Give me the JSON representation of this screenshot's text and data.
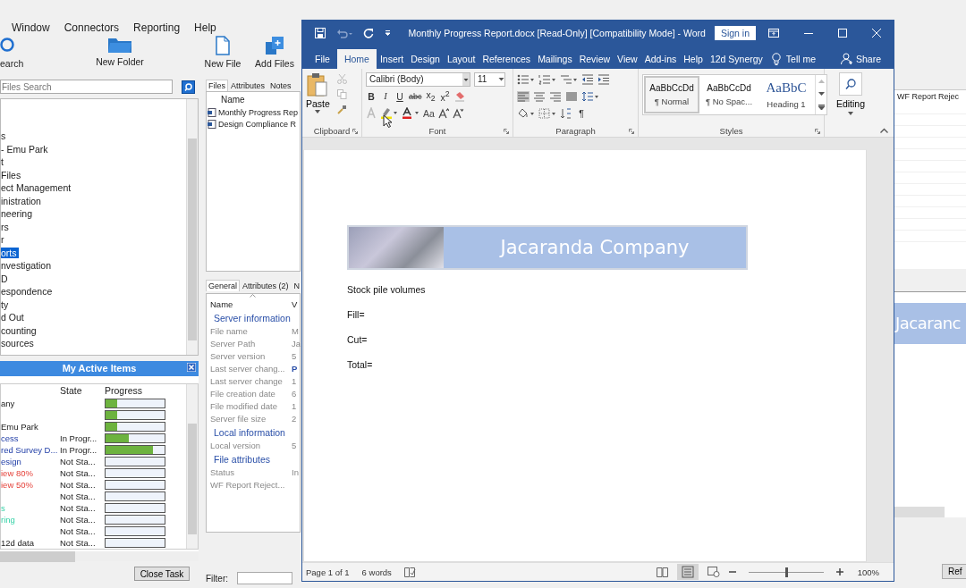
{
  "app": {
    "menu": [
      "Window",
      "Connectors",
      "Reporting",
      "Help"
    ],
    "toolbar": [
      {
        "label": "earch",
        "kind": "search"
      },
      {
        "label": "New Folder",
        "kind": "folder"
      },
      {
        "label": "New File",
        "kind": "file"
      },
      {
        "label": "Add Files",
        "kind": "add"
      }
    ],
    "search": {
      "placeholder": "Files Search"
    },
    "tree": [
      {
        "label": "s",
        "selected": false
      },
      {
        "label": "- Emu Park",
        "selected": false
      },
      {
        "label": "t",
        "selected": false
      },
      {
        "label": "Files",
        "selected": false
      },
      {
        "label": "ect Management",
        "selected": false
      },
      {
        "label": "inistration",
        "selected": false
      },
      {
        "label": "neering",
        "selected": false
      },
      {
        "label": "rs",
        "selected": false
      },
      {
        "label": "r",
        "selected": false
      },
      {
        "label": "orts",
        "selected": true
      },
      {
        "label": "nvestigation",
        "selected": false
      },
      {
        "label": "D",
        "selected": false
      },
      {
        "label": "espondence",
        "selected": false
      },
      {
        "label": "ty",
        "selected": false
      },
      {
        "label": "d Out",
        "selected": false
      },
      {
        "label": "counting",
        "selected": false
      },
      {
        "label": "sources",
        "selected": false
      }
    ],
    "active_items": {
      "title": "My Active Items",
      "columns": [
        "State",
        "Progress"
      ],
      "rows": [
        {
          "name": "any",
          "kind": "black",
          "level": 0.2
        },
        {
          "level": 0.2
        },
        {
          "name": "Emu Park",
          "kind": "black",
          "level": 0.2
        },
        {
          "name": "cess",
          "kind": "blue",
          "state": "In Progr...",
          "level": 0.4
        },
        {
          "name": "red Survey D...",
          "kind": "blue",
          "state": "In Progr...",
          "level": 0.8
        },
        {
          "name": "esign",
          "kind": "blue",
          "state": "Not Sta...",
          "level": 0
        },
        {
          "name": "iew 80%",
          "kind": "red",
          "state": "Not Sta...",
          "level": 0
        },
        {
          "name": "iew 50%",
          "kind": "red",
          "state": "Not Sta...",
          "level": 0
        },
        {
          "state": "Not Sta...",
          "level": 0
        },
        {
          "name": "s",
          "kind": "teal",
          "state": "Not Sta...",
          "level": 0
        },
        {
          "name": "ring",
          "kind": "teal",
          "state": "Not Sta...",
          "level": 0
        },
        {
          "state": "Not Sta...",
          "level": 0
        },
        {
          "name": "12d data",
          "kind": "black",
          "state": "Not Sta...",
          "level": 0
        }
      ],
      "button": "Close Task"
    },
    "file_tabs": [
      {
        "label": "Files",
        "selected": true
      },
      {
        "label": "Attributes",
        "selected": false
      },
      {
        "label": "Notes",
        "selected": false
      }
    ],
    "files": {
      "column": "Name",
      "rows": [
        "Monthly Progress Rep",
        "Design Compliance R"
      ]
    },
    "detail_tabs": [
      {
        "label": "General",
        "selected": true
      },
      {
        "label": "Attributes (2)",
        "selected": false
      },
      {
        "label": "N",
        "selected": false
      }
    ],
    "properties": {
      "columns": [
        "Name",
        "V"
      ],
      "groups": [
        {
          "title": "Server information",
          "rows": [
            {
              "name": "File name",
              "value": "M",
              "kind": "text"
            },
            {
              "name": "Server Path",
              "value": "Ja",
              "kind": "text"
            },
            {
              "name": "Server version",
              "value": "5",
              "kind": "text"
            },
            {
              "name": "Last server chang...",
              "value": "P",
              "kind": "link"
            },
            {
              "name": "Last server change",
              "value": "1",
              "kind": "text"
            },
            {
              "name": "File creation date",
              "value": "6",
              "kind": "text"
            },
            {
              "name": "File modified date",
              "value": "1",
              "kind": "text"
            },
            {
              "name": "Server file size",
              "value": "2",
              "kind": "text"
            }
          ]
        },
        {
          "title": "Local information",
          "rows": [
            {
              "name": "Local version",
              "value": "5",
              "kind": "text"
            }
          ]
        },
        {
          "title": "File attributes",
          "rows": [
            {
              "name": "Status",
              "value": "In",
              "kind": "text"
            },
            {
              "name": "WF Report Reject..."
            }
          ]
        }
      ]
    },
    "filter": {
      "label": "Filter:"
    },
    "side": {
      "column": "WF Report Rejec",
      "preview": "Jacaranc",
      "button": "Ref"
    }
  },
  "word": {
    "title": "Monthly Progress Report.docx [Read-Only] [Compatibility Mode]  -  Word",
    "sign_in": "Sign in",
    "tabs": [
      {
        "label": "File",
        "selected": false
      },
      {
        "label": "Home",
        "selected": true
      },
      {
        "label": "Insert",
        "selected": false
      },
      {
        "label": "Design",
        "selected": false
      },
      {
        "label": "Layout",
        "selected": false
      },
      {
        "label": "References",
        "selected": false
      },
      {
        "label": "Mailings",
        "selected": false
      },
      {
        "label": "Review",
        "selected": false
      },
      {
        "label": "View",
        "selected": false
      },
      {
        "label": "Add-ins",
        "selected": false
      },
      {
        "label": "Help",
        "selected": false
      },
      {
        "label": "12d Synergy",
        "selected": false
      }
    ],
    "tell_me": "Tell me",
    "share": "Share",
    "ribbon": {
      "clipboard": {
        "paste": "Paste",
        "label": "Clipboard"
      },
      "font": {
        "fields": [
          "Calibri (Body)",
          "11"
        ],
        "buttons": [
          {
            "label": "B",
            "kind": "bold"
          },
          {
            "label": "I",
            "kind": "italic"
          },
          {
            "label": "U",
            "kind": "underline"
          },
          {
            "label": "abc",
            "kind": "strike"
          },
          {
            "label": "x$_{2}$",
            "kind": "plain"
          },
          {
            "label": "x$^{2}$",
            "kind": "plain"
          }
        ],
        "case": "Aa",
        "label": "Font"
      },
      "paragraph": {
        "pilcrow": "¶",
        "label": "Paragraph"
      },
      "styles": {
        "items": [
          {
            "preview": "AaBbCcDd",
            "name": "¶ Normal",
            "kind": "body",
            "selected": true
          },
          {
            "preview": "AaBbCcDd",
            "name": "¶ No Spac...",
            "kind": "body",
            "selected": false
          },
          {
            "preview": "AaBbC",
            "name": "Heading 1",
            "kind": "heading",
            "selected": false
          }
        ],
        "label": "Styles"
      },
      "editing": {
        "label": "Editing"
      }
    },
    "document": {
      "banner": "Jacaranda Company",
      "paragraphs": [
        "Stock pile volumes",
        "Fill=",
        "Cut=",
        "Total="
      ]
    },
    "status": {
      "page": "Page 1 of 1",
      "words": "6 words",
      "zoom_slider": {
        "level": 0.5
      },
      "zoom": "100%"
    }
  }
}
